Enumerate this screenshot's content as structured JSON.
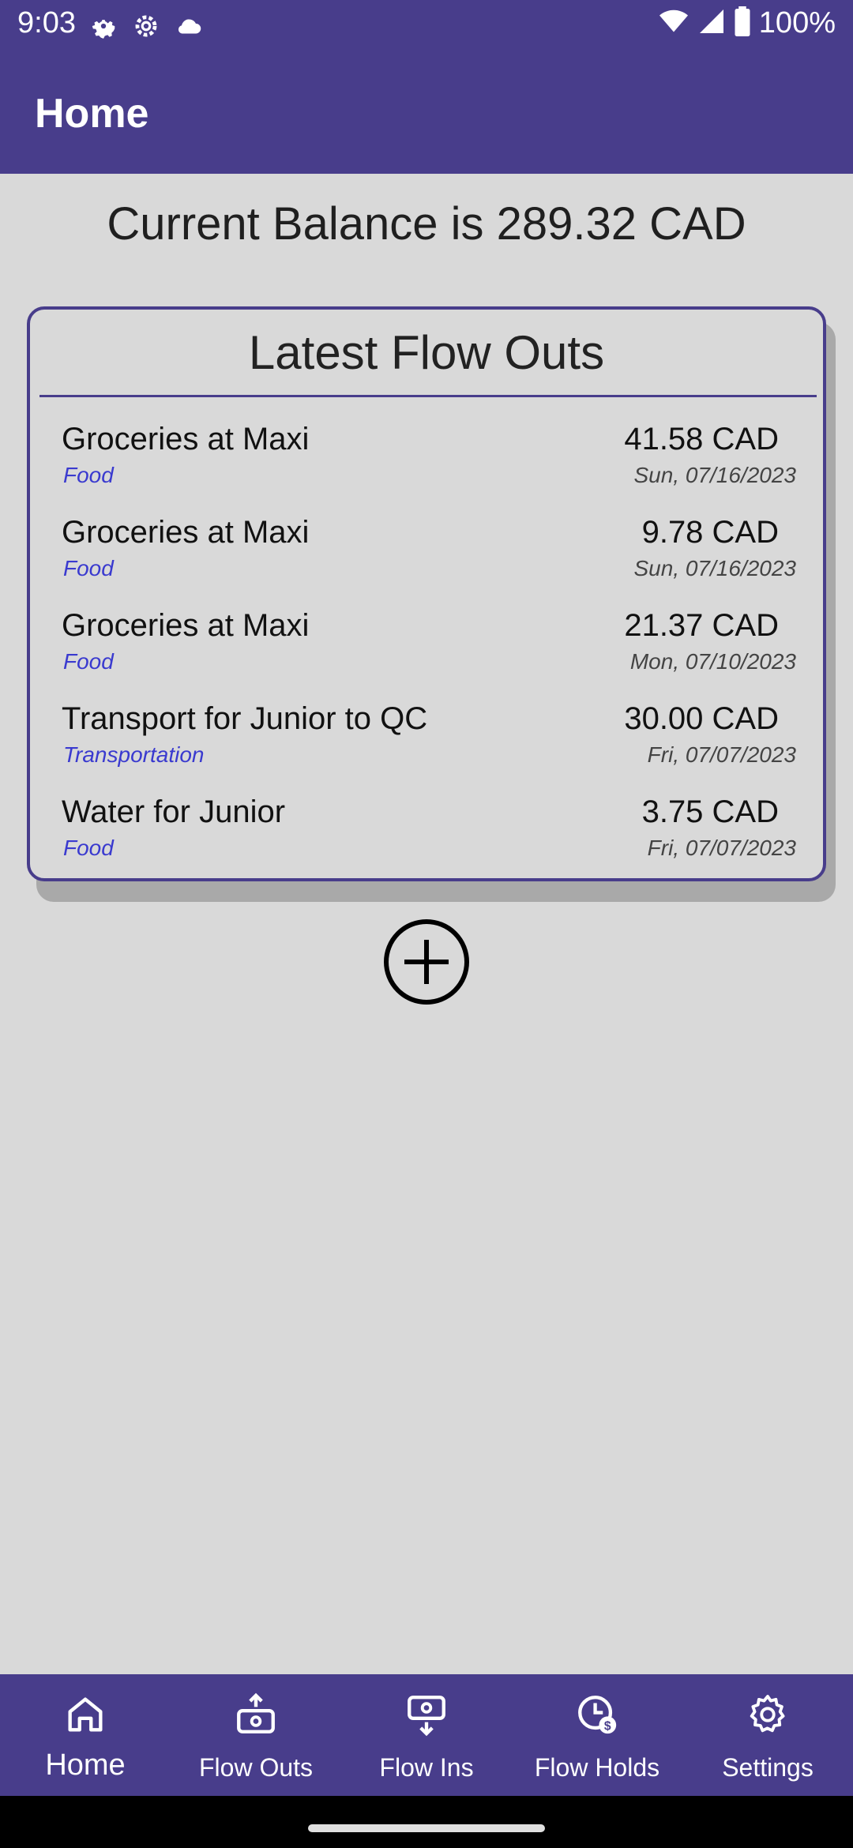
{
  "status_bar": {
    "time": "9:03",
    "battery": "100%",
    "icons": [
      "gear-icon",
      "gear-outline-icon",
      "cloud-icon",
      "wifi-icon",
      "signal-icon",
      "battery-icon"
    ]
  },
  "app_bar": {
    "title": "Home"
  },
  "balance": {
    "text": "Current Balance is 289.32 CAD"
  },
  "flow_outs_card": {
    "title": "Latest Flow Outs",
    "items": [
      {
        "name": "Groceries at Maxi",
        "category": "Food",
        "amount": "41.58 CAD",
        "date": "Sun, 07/16/2023"
      },
      {
        "name": "Groceries at Maxi",
        "category": "Food",
        "amount": "9.78 CAD",
        "date": "Sun, 07/16/2023"
      },
      {
        "name": "Groceries at Maxi",
        "category": "Food",
        "amount": "21.37 CAD",
        "date": "Mon, 07/10/2023"
      },
      {
        "name": "Transport for Junior to QC",
        "category": "Transportation",
        "amount": "30.00 CAD",
        "date": "Fri, 07/07/2023"
      },
      {
        "name": "Water for Junior",
        "category": "Food",
        "amount": "3.75 CAD",
        "date": "Fri, 07/07/2023"
      }
    ]
  },
  "add_button": {
    "icon": "plus-circle-icon"
  },
  "bottom_nav": {
    "items": [
      {
        "label": "Home",
        "icon": "home-icon",
        "active": true
      },
      {
        "label": "Flow Outs",
        "icon": "flow-outs-icon",
        "active": false
      },
      {
        "label": "Flow Ins",
        "icon": "flow-ins-icon",
        "active": false
      },
      {
        "label": "Flow Holds",
        "icon": "flow-holds-icon",
        "active": false
      },
      {
        "label": "Settings",
        "icon": "settings-icon",
        "active": false
      }
    ]
  },
  "colors": {
    "primary": "#483d8b",
    "background": "#d9d9d9",
    "category_text": "#3a3acf"
  }
}
